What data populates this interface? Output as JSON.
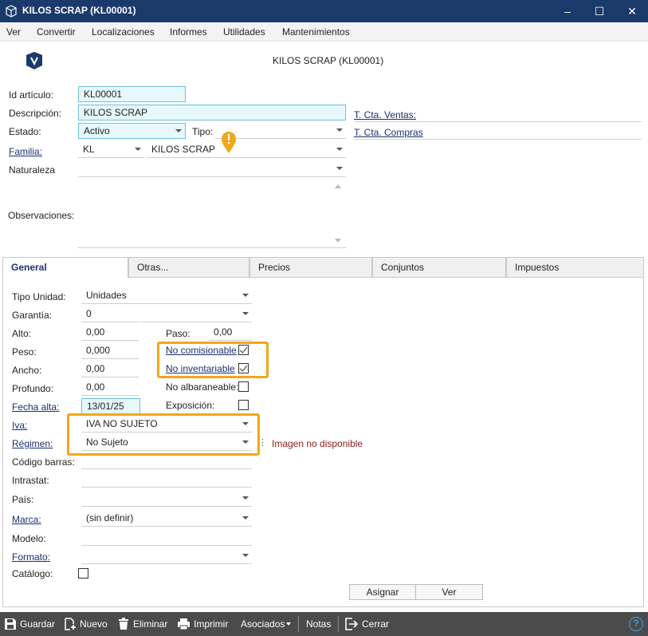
{
  "window": {
    "title": "KILOS SCRAP (KL00001)",
    "minimize": "–",
    "maximize": "☐",
    "close": "✕"
  },
  "menu": [
    "Ver",
    "Convertir",
    "Localizaciones",
    "Informes",
    "Utilidades",
    "Mantenimientos"
  ],
  "header": {
    "title": "KILOS SCRAP (KL00001)"
  },
  "form": {
    "id_label": "Id artículo:",
    "id_value": "KL00001",
    "desc_label": "Descripción:",
    "desc_value": "KILOS SCRAP",
    "estado_label": "Estado:",
    "estado_value": "Activo",
    "tipo_label": "Tipo:",
    "tipo_value": "",
    "familia_label": "Familia:",
    "familia_code": "KL",
    "familia_name": "KILOS SCRAP",
    "naturaleza_label": "Naturaleza",
    "naturaleza_value": "",
    "obs_label": "Observaciones:",
    "ventas_label": "T. Cta. Ventas:",
    "compras_label": "T. Cta. Compras"
  },
  "tabs": [
    "General",
    "Otras...",
    "Precios",
    "Conjuntos",
    "Impuestos"
  ],
  "general": {
    "tipo_unidad_label": "Tipo Unidad:",
    "tipo_unidad_value": "Unidades",
    "garantia_label": "Garantía:",
    "garantia_value": "0",
    "alto_label": "Alto:",
    "alto_value": "0,00",
    "paso_label": "Paso:",
    "paso_value": "0,00",
    "peso_label": "Peso:",
    "peso_value": "0,000",
    "ancho_label": "Ancho:",
    "ancho_value": "0,00",
    "profundo_label": "Profundo:",
    "profundo_value": "0,00",
    "fecha_alta_label": "Fecha alta:",
    "fecha_alta_value": "13/01/25",
    "no_comisionable_label": "No comisionable",
    "no_comisionable_checked": true,
    "no_inventariable_label": "No inventariable",
    "no_inventariable_checked": true,
    "no_albaraneable_label": "No albaraneable:",
    "no_albaraneable_checked": false,
    "exposicion_label": "Exposición:",
    "exposicion_checked": false,
    "iva_label": "Iva:",
    "iva_value": "IVA NO SUJETO",
    "regimen_label": "Régimen:",
    "regimen_value": "No Sujeto",
    "imagen_text": "Imagen no disponible",
    "codigo_barras_label": "Código barras:",
    "intrastat_label": "Intrastat:",
    "pais_label": "País:",
    "marca_label": "Marca:",
    "marca_value": "(sin definir)",
    "modelo_label": "Modelo:",
    "formato_label": "Formato:",
    "catalogo_label": "Catálogo:",
    "catalogo_checked": false,
    "asignar_label": "Asignar",
    "ver_label": "Ver"
  },
  "toolbar": {
    "guardar": "Guardar",
    "nuevo": "Nuevo",
    "eliminar": "Eliminar",
    "imprimir": "Imprimir",
    "asociados": "Asociados",
    "notas": "Notas",
    "cerrar": "Cerrar",
    "help": "?"
  },
  "colors": {
    "titlebar": "#1a3a6b",
    "highlight": "#f0a818",
    "toolbar": "#4b4b4b",
    "field_fill": "#e6f8fb"
  }
}
